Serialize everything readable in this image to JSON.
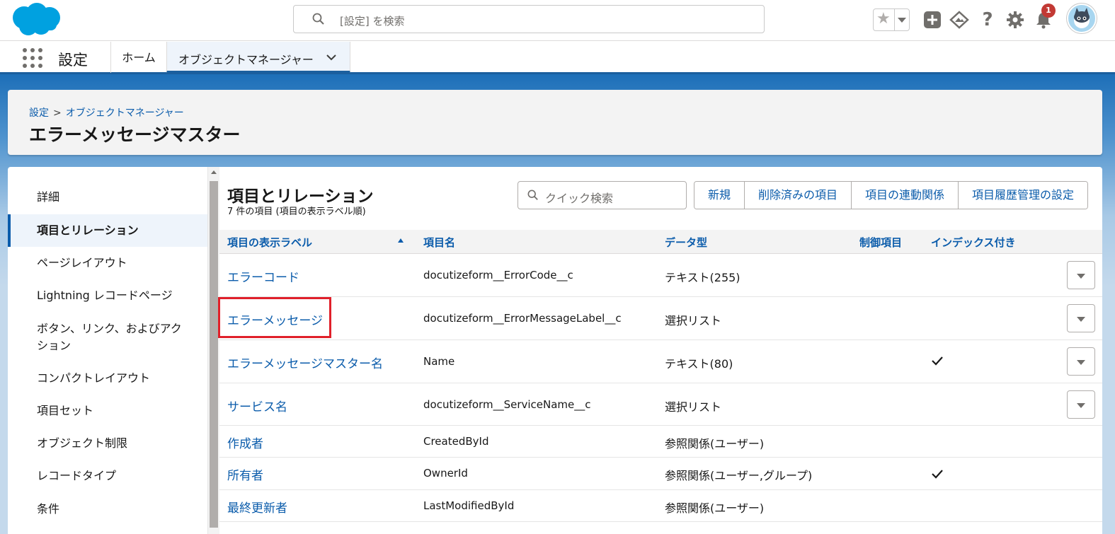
{
  "header": {
    "search_placeholder": "[設定] を検索",
    "notification_count": "1"
  },
  "nav": {
    "app_name": "設定",
    "tabs": [
      {
        "label": "ホーム"
      },
      {
        "label": "オブジェクトマネージャー"
      }
    ]
  },
  "page": {
    "breadcrumb": [
      "設定",
      "オブジェクトマネージャー"
    ],
    "breadcrumb_sep": ">",
    "title": "エラーメッセージマスター"
  },
  "sidebar": {
    "items": [
      {
        "label": "詳細"
      },
      {
        "label": "項目とリレーション",
        "active": true
      },
      {
        "label": "ページレイアウト"
      },
      {
        "label": "Lightning レコードページ"
      },
      {
        "label": "ボタン、リンク、およびアク",
        "label2": "ション"
      },
      {
        "label": "コンパクトレイアウト"
      },
      {
        "label": "項目セット"
      },
      {
        "label": "オブジェクト制限"
      },
      {
        "label": "レコードタイプ"
      },
      {
        "label": "条件"
      }
    ]
  },
  "section": {
    "title": "項目とリレーション",
    "subtitle": "7 件の項目 (項目の表示ラベル順)",
    "quick_search_placeholder": "クイック検索",
    "buttons": [
      "新規",
      "削除済みの項目",
      "項目の連動関係",
      "項目履歴管理の設定"
    ]
  },
  "table": {
    "columns": [
      "項目の表示ラベル",
      "項目名",
      "データ型",
      "制御項目",
      "インデックス付き"
    ],
    "rows": [
      {
        "label": "エラーコード",
        "api": "docutizeform__ErrorCode__c",
        "type": "テキスト(255)",
        "controlling": "",
        "indexed": false,
        "menu": true
      },
      {
        "label": "エラーメッセージ",
        "api": "docutizeform__ErrorMessageLabel__c",
        "type": "選択リスト",
        "controlling": "",
        "indexed": false,
        "menu": true,
        "highlighted": true
      },
      {
        "label": "エラーメッセージマスター名",
        "api": "Name",
        "type": "テキスト(80)",
        "controlling": "",
        "indexed": true,
        "menu": true
      },
      {
        "label": "サービス名",
        "api": "docutizeform__ServiceName__c",
        "type": "選択リスト",
        "controlling": "",
        "indexed": false,
        "menu": true
      },
      {
        "label": "作成者",
        "api": "CreatedById",
        "type": "参照関係(ユーザー)",
        "controlling": "",
        "indexed": false,
        "menu": false
      },
      {
        "label": "所有者",
        "api": "OwnerId",
        "type": "参照関係(ユーザー,グループ)",
        "controlling": "",
        "indexed": true,
        "menu": false
      },
      {
        "label": "最終更新者",
        "api": "LastModifiedById",
        "type": "参照関係(ユーザー)",
        "controlling": "",
        "indexed": false,
        "menu": false
      }
    ]
  },
  "colors": {
    "brand": "#0b5cab",
    "highlight": "#e0202a",
    "logo": "#00a1e0"
  }
}
